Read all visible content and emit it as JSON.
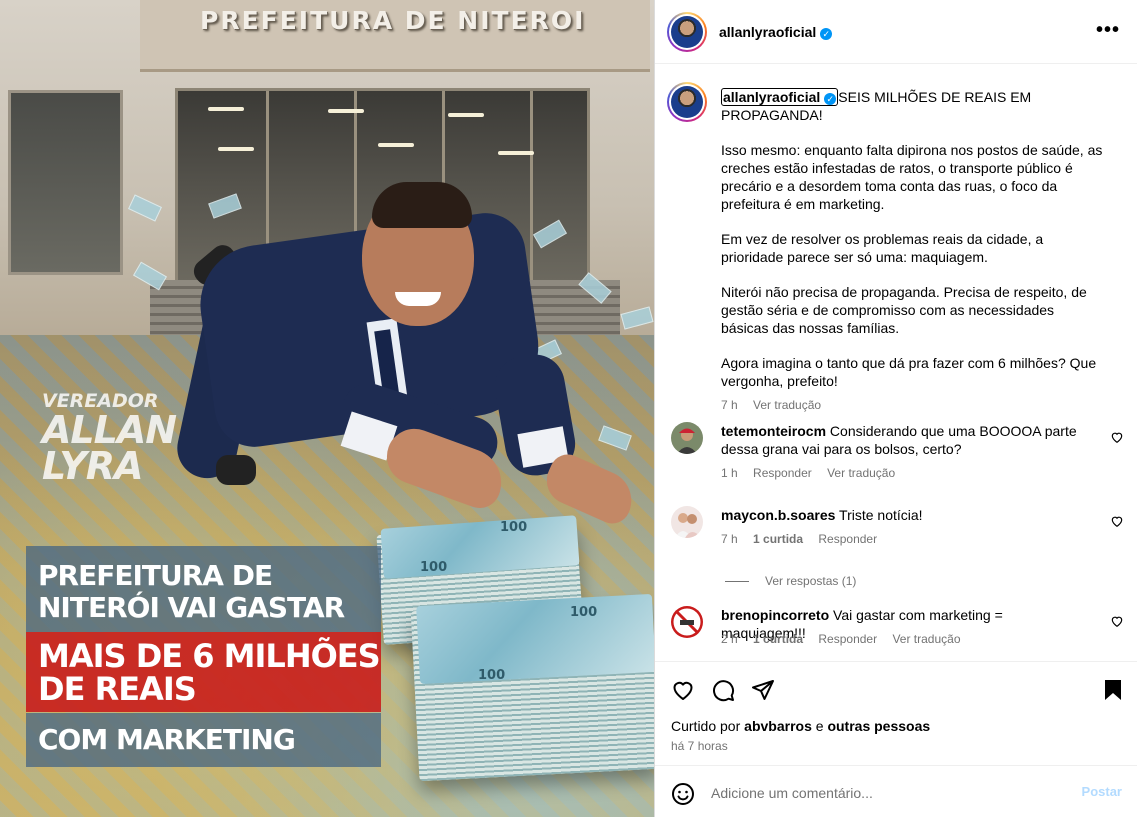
{
  "image": {
    "facade_text": "PREFEITURA DE NITEROI",
    "brand_small": "VEREADOR",
    "brand_line1": "ALLAN",
    "brand_line2": "LYRA",
    "banner1": "PREFEITURA DE NITERÓI VAI GASTAR",
    "banner2": "MAIS DE 6 MILHÕES DE REAIS",
    "banner3": "COM MARKETING",
    "note_value": "100"
  },
  "header": {
    "username": "allanlyraoficial",
    "verified_glyph": "✓",
    "more_glyph": "•••"
  },
  "caption": {
    "username": "allanlyraoficial",
    "headline": "SEIS MILHÕES DE REAIS EM PROPAGANDA!",
    "p1": "Isso mesmo: enquanto falta dipirona nos postos de saúde, as creches estão infestadas de ratos, o transporte público é precário e a desordem toma conta das ruas, o foco da prefeitura é em marketing.",
    "p2": "Em vez de resolver os problemas reais da cidade, a prioridade parece ser só uma: maquiagem.",
    "p3": "Niterói não precisa de propaganda. Precisa de respeito, de gestão séria e de compromisso com as necessidades básicas das nossas famílias.",
    "p4": "Agora imagina o tanto que dá pra fazer com 6 milhões? Que vergonha, prefeito!",
    "time": "7 h",
    "translate": "Ver tradução"
  },
  "comments": [
    {
      "username": "tetemonteirocm",
      "text": "Considerando que uma BOOOOA parte dessa grana vai para os bolsos, certo?",
      "time": "1 h",
      "reply": "Responder",
      "translate": "Ver tradução"
    },
    {
      "username": "maycon.b.soares",
      "text": "Triste notícia!",
      "time": "7 h",
      "likes": "1 curtida",
      "reply": "Responder",
      "view_replies": "Ver respostas (1)"
    },
    {
      "username": "brenopincorreto",
      "text": "Vai gastar com marketing = maquiagem!!!",
      "time": "2 h",
      "likes": "1 curtida",
      "reply": "Responder",
      "translate": "Ver tradução"
    }
  ],
  "footer": {
    "liked_prefix": "Curtido por",
    "liked_user": "abvbarros",
    "liked_joiner": "e",
    "liked_others": "outras pessoas",
    "time": "há 7 horas",
    "comment_placeholder": "Adicione um comentário...",
    "post_label": "Postar"
  },
  "icons": {
    "like": "heart-icon",
    "comment": "comment-icon",
    "share": "share-icon",
    "save": "bookmark-icon",
    "emoji": "emoji-icon"
  },
  "colors": {
    "accent_blue": "#0095f6",
    "muted": "#737373",
    "post_disabled": "#b3dbff",
    "banner_red": "#c81919",
    "banner_blue": "#46648f"
  }
}
